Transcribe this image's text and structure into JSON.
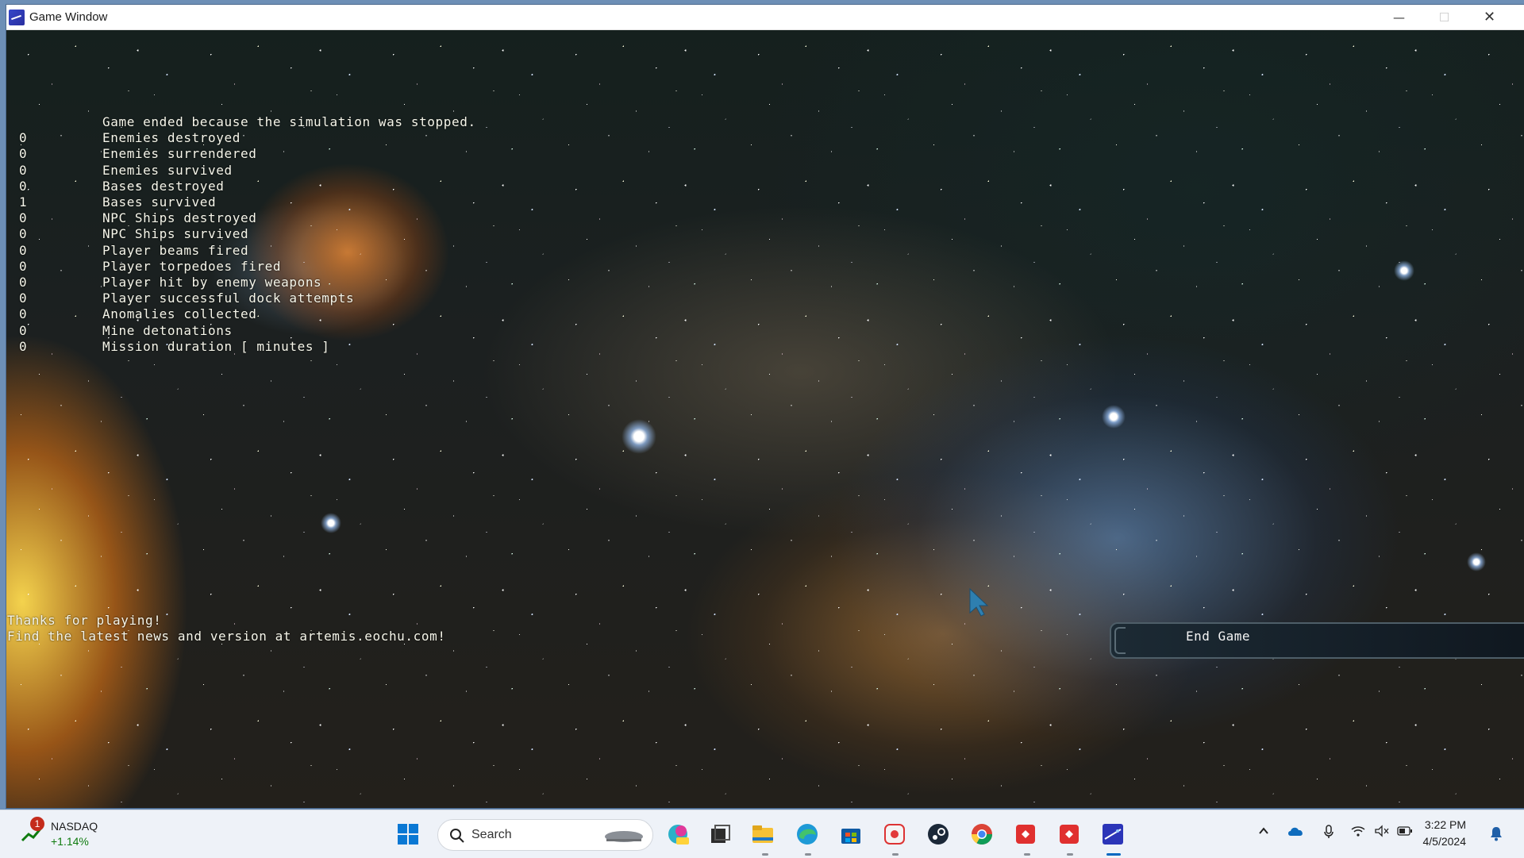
{
  "window": {
    "title": "Game Window",
    "controls": {
      "minimize": "—",
      "maximize": "☐",
      "close": "✕"
    }
  },
  "game": {
    "end_message": "Game ended because the simulation was stopped.",
    "stats": [
      {
        "value": "0",
        "label": "Enemies destroyed"
      },
      {
        "value": "0",
        "label": "Enemies surrendered"
      },
      {
        "value": "0",
        "label": "Enemies survived"
      },
      {
        "value": "0",
        "label": "Bases destroyed"
      },
      {
        "value": "1",
        "label": "Bases survived"
      },
      {
        "value": "0",
        "label": "NPC Ships destroyed"
      },
      {
        "value": "0",
        "label": "NPC Ships survived"
      },
      {
        "value": "0",
        "label": "Player beams fired"
      },
      {
        "value": "0",
        "label": "Player torpedoes fired"
      },
      {
        "value": "0",
        "label": "Player hit by enemy weapons"
      },
      {
        "value": "0",
        "label": "Player successful dock attempts"
      },
      {
        "value": "0",
        "label": "Anomalies collected"
      },
      {
        "value": "0",
        "label": "Mine detonations"
      },
      {
        "value": "0",
        "label": "Mission duration [ minutes ]"
      }
    ],
    "footer_line1": "Thanks for playing!",
    "footer_line2": "Find the latest news and version at artemis.eochu.com!",
    "end_game_button": "End Game"
  },
  "taskbar": {
    "ticker": {
      "badge": "1",
      "name": "NASDAQ",
      "change": "+1.14%"
    },
    "search_placeholder": "Search",
    "apps": [
      "copilot-icon",
      "task-view-icon",
      "file-explorer-icon",
      "edge-icon",
      "microsoft-store-icon",
      "snipping-tool-icon",
      "steam-icon",
      "chrome-icon",
      "app-red-1-icon",
      "app-red-2-icon",
      "artemis-game-icon"
    ],
    "clock": {
      "time": "3:22 PM",
      "date": "4/5/2024"
    }
  },
  "colors": {
    "stat_text": "#f6f6ea",
    "taskbar_bg": "#eef2f8",
    "accent": "#0067c0"
  }
}
